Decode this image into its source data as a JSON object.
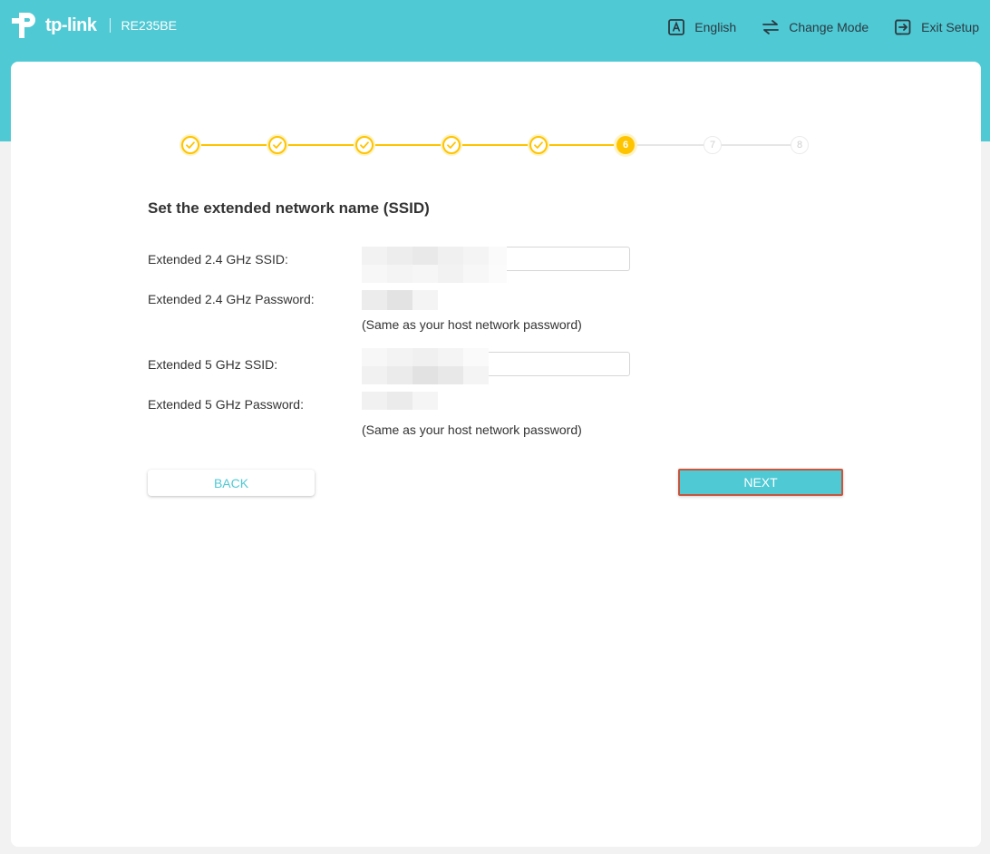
{
  "header": {
    "brand": "tp-link",
    "model": "RE235BE",
    "nav": {
      "language": "English",
      "change_mode": "Change Mode",
      "exit_setup": "Exit Setup"
    }
  },
  "stepper": {
    "steps": [
      {
        "label": "",
        "state": "done"
      },
      {
        "label": "",
        "state": "done"
      },
      {
        "label": "",
        "state": "done"
      },
      {
        "label": "",
        "state": "done"
      },
      {
        "label": "",
        "state": "done"
      },
      {
        "label": "6",
        "state": "current"
      },
      {
        "label": "7",
        "state": "todo"
      },
      {
        "label": "8",
        "state": "todo"
      }
    ],
    "current_step": 6,
    "total_steps": 8
  },
  "form": {
    "title": "Set the extended network name (SSID)",
    "ssid_24_label": "Extended 2.4 GHz SSID:",
    "ssid_24_value": "",
    "password_24_label": "Extended 2.4 GHz Password:",
    "password_24_hint": "(Same as your host network password)",
    "ssid_5_label": "Extended 5 GHz SSID:",
    "ssid_5_value": "",
    "password_5_label": "Extended 5 GHz Password:",
    "password_5_hint": "(Same as your host network password)"
  },
  "buttons": {
    "back": "BACK",
    "next": "NEXT"
  },
  "colors": {
    "brand_teal": "#4fc9d4",
    "step_yellow": "#ffc400",
    "next_focus_border": "#c8553d"
  }
}
